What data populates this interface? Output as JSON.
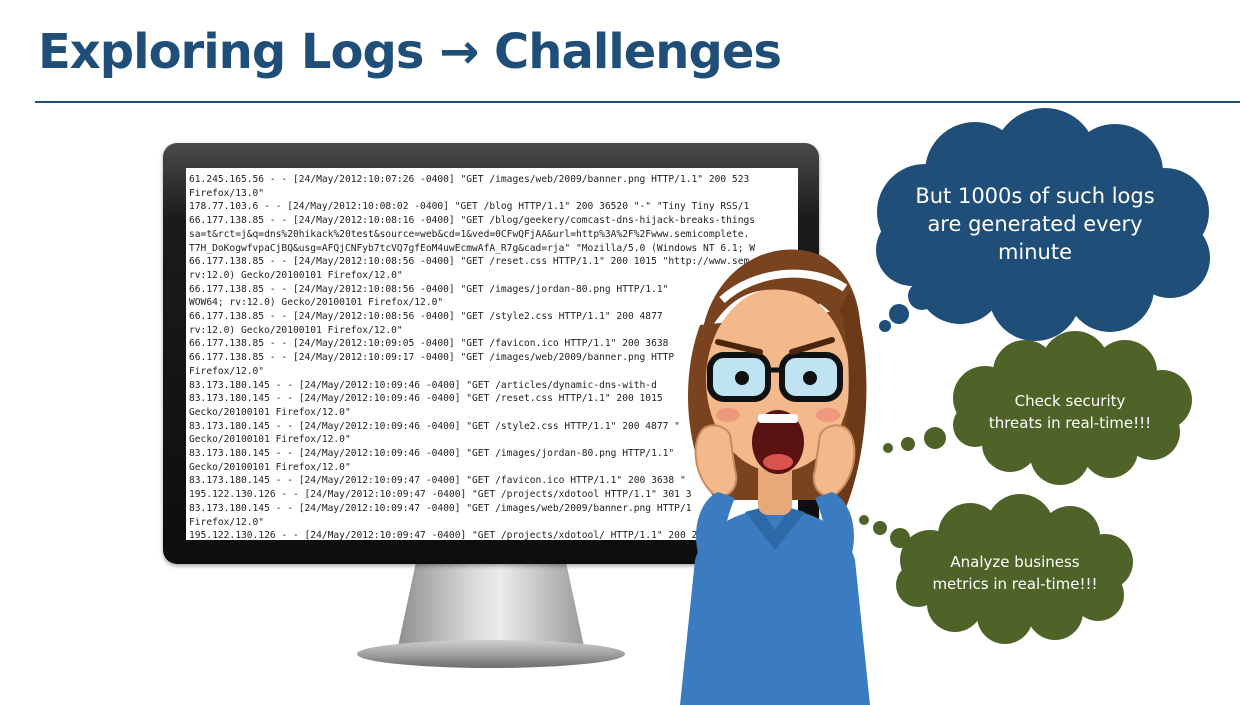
{
  "slide": {
    "title": "Exploring Logs → Challenges"
  },
  "monitor": {
    "log_lines": [
      "61.245.165.56 - - [24/May/2012:10:07:26 -0400] \"GET /images/web/2009/banner.png HTTP/1.1\" 200 523",
      "Firefox/13.0\"",
      "178.77.103.6 - - [24/May/2012:10:08:02 -0400] \"GET /blog HTTP/1.1\" 200 36520 \"-\" \"Tiny Tiny RSS/1",
      "66.177.138.85 - - [24/May/2012:10:08:16 -0400] \"GET /blog/geekery/comcast-dns-hijack-breaks-things",
      "sa=t&rct=j&q=dns%20hikack%20test&source=web&cd=1&ved=0CFwQFjAA&url=http%3A%2F%2Fwww.semicomplete.",
      "T7H_DoKogwfvpaCjBQ&usg=AFQjCNFyb7tcVQ7gfEoM4uwEcmwAfA_R7g&cad=rja\" \"Mozilla/5.0 (Windows NT 6.1; W",
      "66.177.138.85 - - [24/May/2012:10:08:56 -0400] \"GET /reset.css HTTP/1.1\" 200 1015 \"http://www.sem",
      "rv:12.0) Gecko/20100101 Firefox/12.0\"",
      "66.177.138.85 - - [24/May/2012:10:08:56 -0400] \"GET /images/jordan-80.png HTTP/1.1\"",
      "WOW64; rv:12.0) Gecko/20100101 Firefox/12.0\"",
      "66.177.138.85 - - [24/May/2012:10:08:56 -0400] \"GET /style2.css HTTP/1.1\" 200 4877",
      "rv:12.0) Gecko/20100101 Firefox/12.0\"",
      "66.177.138.85 - - [24/May/2012:10:09:05 -0400] \"GET /favicon.ico HTTP/1.1\" 200 3638",
      "66.177.138.85 - - [24/May/2012:10:09:17 -0400] \"GET /images/web/2009/banner.png HTTP",
      "Firefox/12.0\"",
      "83.173.180.145 - - [24/May/2012:10:09:46 -0400] \"GET /articles/dynamic-dns-with-d",
      "83.173.180.145 - - [24/May/2012:10:09:46 -0400] \"GET /reset.css HTTP/1.1\" 200 1015",
      "Gecko/20100101 Firefox/12.0\"",
      "83.173.180.145 - - [24/May/2012:10:09:46 -0400] \"GET /style2.css HTTP/1.1\" 200 4877 \"",
      "Gecko/20100101 Firefox/12.0\"",
      "83.173.180.145 - - [24/May/2012:10:09:46 -0400] \"GET /images/jordan-80.png HTTP/1.1\"",
      "Gecko/20100101 Firefox/12.0\"",
      "83.173.180.145 - - [24/May/2012:10:09:47 -0400] \"GET /favicon.ico HTTP/1.1\" 200 3638 \"",
      "195.122.130.126 - - [24/May/2012:10:09:47 -0400] \"GET /projects/xdotool HTTP/1.1\" 301 3",
      "83.173.180.145 - - [24/May/2012:10:09:47 -0400] \"GET /images/web/2009/banner.png HTTP/1",
      "Firefox/12.0\"",
      "195.122.130.126 - - [24/May/2012:10:09:47 -0400] \"GET /projects/xdotool/ HTTP/1.1\" 200 251"
    ]
  },
  "bubbles": {
    "blue": {
      "line1": "But 1000s of such logs",
      "line2": "are generated every",
      "line3": "minute",
      "color": "#1f4e79"
    },
    "olive1": {
      "line1": "Check security",
      "line2": "threats in real-time!!!",
      "color": "#4f6228"
    },
    "olive2": {
      "line1": "Analyze business",
      "line2": "metrics in real-time!!!",
      "color": "#4f6228"
    }
  },
  "colors": {
    "title": "#1f4e79",
    "shirt": "#3b7bbf",
    "hair": "#7a4320",
    "skin": "#f3b98a"
  }
}
